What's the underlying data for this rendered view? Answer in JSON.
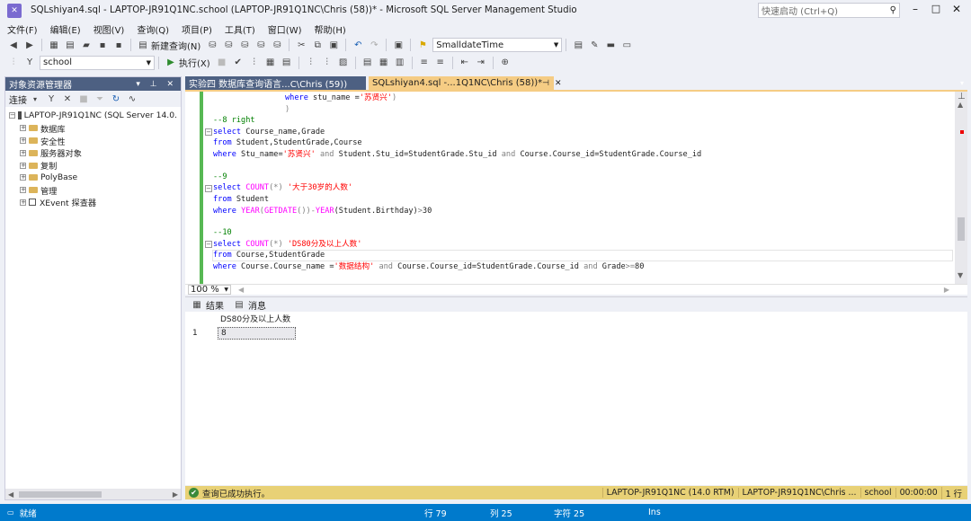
{
  "window": {
    "title": "SQLshiyan4.sql - LAPTOP-JR91Q1NC.school (LAPTOP-JR91Q1NC\\Chris (58))* - Microsoft SQL Server Management Studio",
    "quick_launch_placeholder": "快速启动 (Ctrl+Q)"
  },
  "menu": [
    "文件(F)",
    "编辑(E)",
    "视图(V)",
    "查询(Q)",
    "项目(P)",
    "工具(T)",
    "窗口(W)",
    "帮助(H)"
  ],
  "toolbar": {
    "new_query_label": "新建查询(N)",
    "solution_config": "SmalldateTime",
    "database": "school",
    "execute_label": "执行(X)"
  },
  "object_explorer": {
    "title": "对象资源管理器",
    "connect_label": "连接",
    "server": "LAPTOP-JR91Q1NC (SQL Server 14.0.",
    "nodes": [
      "数据库",
      "安全性",
      "服务器对象",
      "复制",
      "PolyBase",
      "管理",
      "XEvent 探查器"
    ]
  },
  "tabs": [
    {
      "label": "实验四 数据库查询语言...C\\Chris (59))",
      "active": false
    },
    {
      "label": "SQLshiyan4.sql -...1Q1NC\\Chris (58))*",
      "active": true
    }
  ],
  "code": {
    "l1": [
      "where",
      " stu_name =",
      "'苏贤兴'",
      ")"
    ],
    "l2": ")",
    "l3": "--8 right",
    "l4": [
      "select",
      " Course_name,Grade"
    ],
    "l5": [
      "from",
      " Student,StudentGrade,Course"
    ],
    "l6": [
      "where",
      " Stu_name=",
      "'苏贤兴'",
      " and ",
      "Student.Stu_id=StudentGrade.Stu_id",
      " and ",
      "Course.Course_id=StudentGrade.Course_id"
    ],
    "l7": "--9",
    "l8": [
      "select",
      " ",
      "COUNT",
      "(*)",
      " ",
      "'大于30岁的人数'"
    ],
    "l9": [
      "from",
      " Student"
    ],
    "l10": [
      "where",
      " ",
      "YEAR",
      "(",
      "GETDATE",
      "())",
      "-",
      "YEAR",
      "(Student.Birthday)",
      ">",
      "30"
    ],
    "l11": "--10",
    "l12": [
      "select",
      " ",
      "COUNT",
      "(*)",
      " ",
      "'DS80分及以上人数'"
    ],
    "l13": [
      "from",
      " Course,StudentGrade"
    ],
    "l14": [
      "where",
      " Course.Course_name =",
      "'数据结构'",
      " and ",
      "Course.Course_id=StudentGrade.Course_id",
      " and ",
      "Grade",
      ">=",
      "80"
    ]
  },
  "zoom": "100 %",
  "results": {
    "tab_results": "结果",
    "tab_messages": "消息",
    "column": "DS80分及以上人数",
    "row_num": "1",
    "value": "8"
  },
  "query_status": {
    "message": "查询已成功执行。",
    "server": "LAPTOP-JR91Q1NC (14.0 RTM)",
    "user": "LAPTOP-JR91Q1NC\\Chris ...",
    "database": "school",
    "elapsed": "00:00:00",
    "rows": "1 行"
  },
  "status_bar": {
    "ready": "就绪",
    "line": "行 79",
    "col": "列 25",
    "char": "字符 25",
    "mode": "Ins"
  },
  "colors": {
    "accent": "#007acc",
    "success_bar": "#e8d176",
    "chrome": "#eef0f6"
  }
}
